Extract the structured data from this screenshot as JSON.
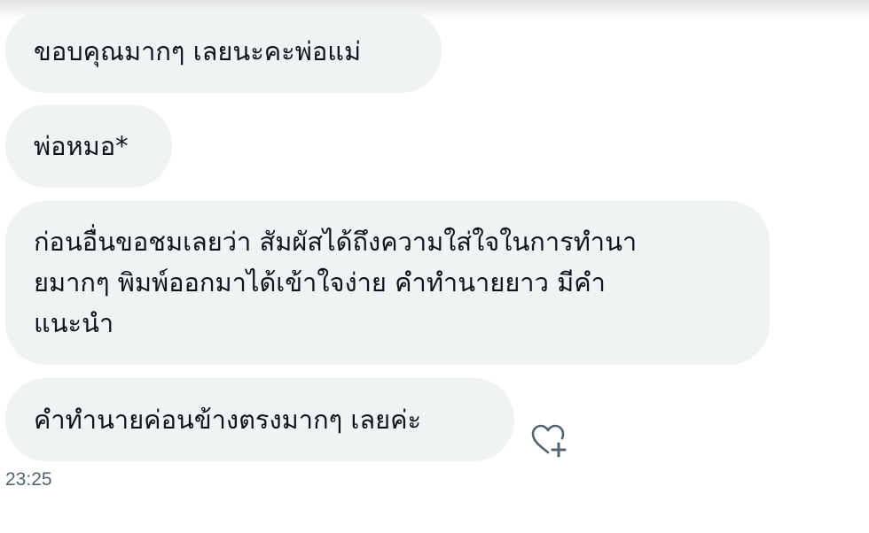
{
  "messages": [
    {
      "text": "ขอบคุณมากๆ เลยนะคะพ่อแม่"
    },
    {
      "text": "พ่อหมอ*"
    },
    {
      "lines": [
        "ก่อนอื่นขอชมเลยว่า สัมผัสได้ถึงความใส่ใจในการทำนา",
        "ยมากๆ พิมพ์ออกมาได้เข้าใจง่าย คำทำนายยาว มีคำ",
        "แนะนำ"
      ]
    },
    {
      "text": "คำทำนายค่อนข้างตรงมากๆ เลยค่ะ"
    }
  ],
  "reaction_icon": "heart-plus-icon",
  "timestamp": "23:25",
  "colors": {
    "bubble_bg": "#eff3f4",
    "text": "#0f1419",
    "muted": "#536471"
  }
}
